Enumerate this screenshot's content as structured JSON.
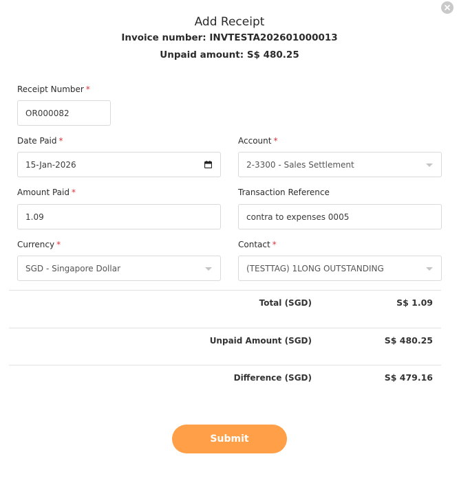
{
  "modal": {
    "title": "Add Receipt",
    "invoice_line": "Invoice number: INVTESTA202601000013",
    "unpaid_line": "Unpaid amount: S$ 480.25"
  },
  "form": {
    "required_mark": "*",
    "receipt_number": {
      "label": "Receipt Number",
      "value": "OR000082"
    },
    "date_paid": {
      "label": "Date Paid",
      "value": "15-Jan-2026"
    },
    "account": {
      "label": "Account",
      "value": "2-3300 - Sales Settlement"
    },
    "amount_paid": {
      "label": "Amount Paid",
      "value": "1.09"
    },
    "transaction_reference": {
      "label": "Transaction Reference",
      "value": "contra to expenses 0005"
    },
    "currency": {
      "label": "Currency",
      "value": "SGD - Singapore Dollar"
    },
    "contact": {
      "label": "Contact",
      "value": "(TESTTAG) 1LONG OUTSTANDING"
    }
  },
  "summary": {
    "total_label": "Total (SGD)",
    "total_value": "S$ 1.09",
    "unpaid_label": "Unpaid Amount (SGD)",
    "unpaid_value": "S$ 480.25",
    "difference_label": "Difference (SGD)",
    "difference_value": "S$ 479.16"
  },
  "actions": {
    "submit_label": "Submit"
  },
  "colors": {
    "accent": "#ff9f47",
    "required": "#e0303a",
    "close_button": "#c9c9c9"
  },
  "icons": {
    "close": "close-icon",
    "calendar": "calendar-icon",
    "dropdown": "chevron-down-icon"
  }
}
